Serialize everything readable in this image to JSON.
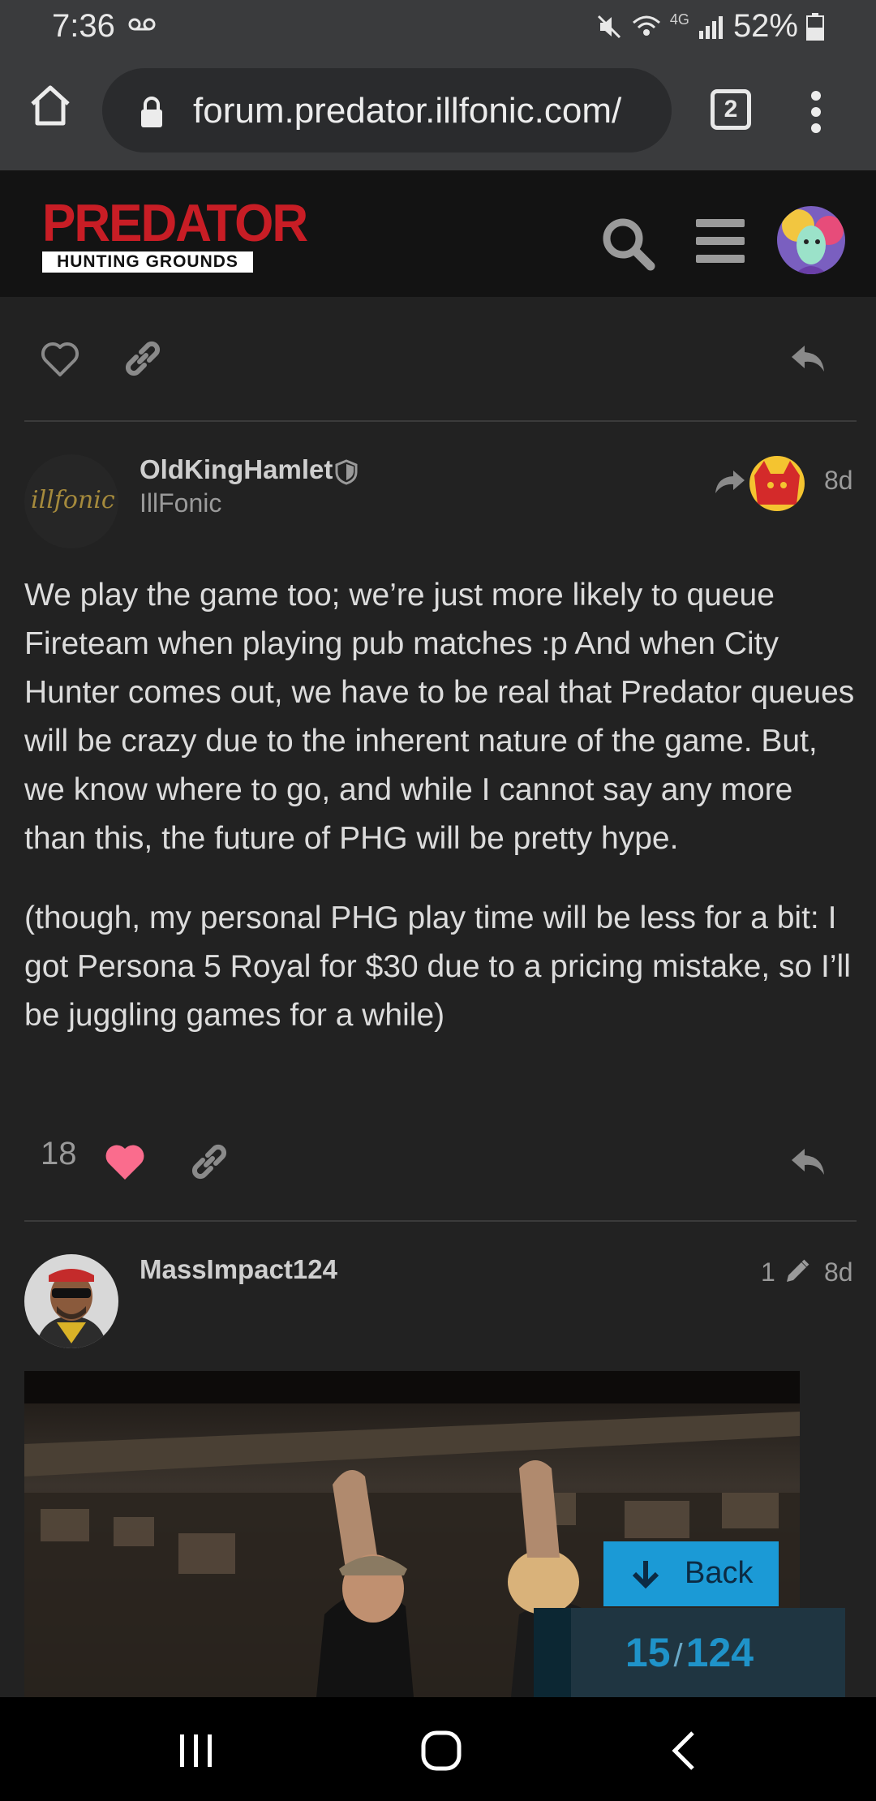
{
  "status_bar": {
    "time": "7:36",
    "network": "4G",
    "battery": "52%"
  },
  "browser": {
    "url": "forum.predator.illfonic.com/",
    "tab_count": "2"
  },
  "forum_header": {
    "logo_top": "PREDATOR",
    "logo_bottom": "HUNTING GROUNDS"
  },
  "posts": [
    {
      "username": "OldKingHamlet",
      "user_title": "IllFonic",
      "avatar_text": "illfonic",
      "age": "8d",
      "paragraphs": [
        "We play the game too; we’re just more likely to queue Fireteam when playing pub matches :p And when City Hunter comes out, we have to be real that Predator queues will be crazy due to the inherent nature of the game. But, we know where to go, and while I cannot say any more than this, the future of PHG will be pretty hype.",
        "(though, my personal PHG play time will be less for a bit: I got Persona 5 Royal for $30 due to a pricing mistake, so I’ll be juggling games for a while)"
      ],
      "like_count": "18"
    },
    {
      "username": "MassImpact124",
      "edit_count": "1",
      "age": "8d"
    }
  ],
  "timeline": {
    "back_label": "Back",
    "current": "15",
    "separator": "/",
    "total": "124",
    "progress": 0.121
  },
  "colors": {
    "accent": "#1b9ad6",
    "like": "#fa6c8d",
    "brand": "#c81d25"
  }
}
